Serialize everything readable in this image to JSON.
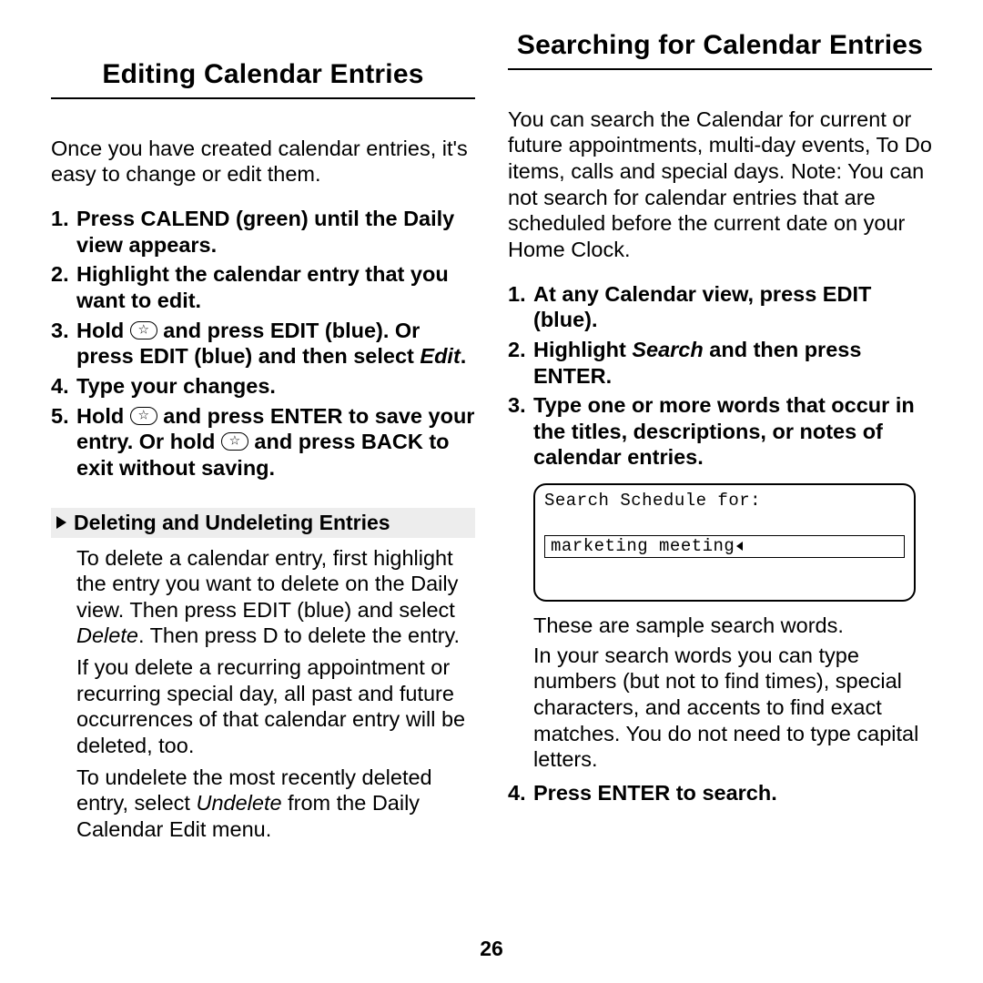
{
  "left": {
    "title": "Editing Calendar Entries",
    "intro": "Once you have created calendar entries, it's easy to change or edit them.",
    "steps": {
      "s1": "Press CALEND (green) until the Daily view appears.",
      "s2": "Highlight the calendar entry that you want to edit.",
      "s3a": "Hold ",
      "s3b": " and press EDIT (blue). Or press EDIT (blue) and then select ",
      "s3c": "Edit",
      "s3d": ".",
      "s4": "Type your changes.",
      "s5a": "Hold ",
      "s5b": " and press ENTER to save your entry. Or hold ",
      "s5c": " and press BACK to exit without saving."
    },
    "subhead": "Deleting and Undeleting Entries",
    "del_p1a": "To delete a calendar entry, first highlight the entry you want to delete on the Daily view. Then press EDIT (blue) and select ",
    "del_p1b": "Delete",
    "del_p1c": ". Then press D to delete the entry.",
    "del_p2": "If you delete a recurring appointment or recurring special day, all past and future occurrences of that calendar entry will be deleted, too.",
    "del_p3a": "To undelete the most recently deleted entry, select ",
    "del_p3b": "Undelete",
    "del_p3c": " from the Daily Calendar Edit menu."
  },
  "right": {
    "title": "Searching for Calendar Entries",
    "intro": "You can search the Calendar for current or future appointments, multi-day events, To Do items, calls and special days. Note: You can not search for calendar entries that are scheduled before the current date on your Home Clock.",
    "steps": {
      "s1": "At any Calendar view, press EDIT (blue).",
      "s2a": "Highlight ",
      "s2b": "Search",
      "s2c": " and then press ENTER.",
      "s3": "Type one or more words that occur in the titles, descriptions, or notes of calendar entries.",
      "s4": "Press ENTER to search."
    },
    "screen_label": "Search Schedule for:",
    "screen_input": "marketing meeting",
    "caption1": "These are sample search words.",
    "caption2": "In your search words you can type numbers (but not to find times), special characters, and accents to find exact matches. You do not need to type capital letters."
  },
  "page_number": "26"
}
